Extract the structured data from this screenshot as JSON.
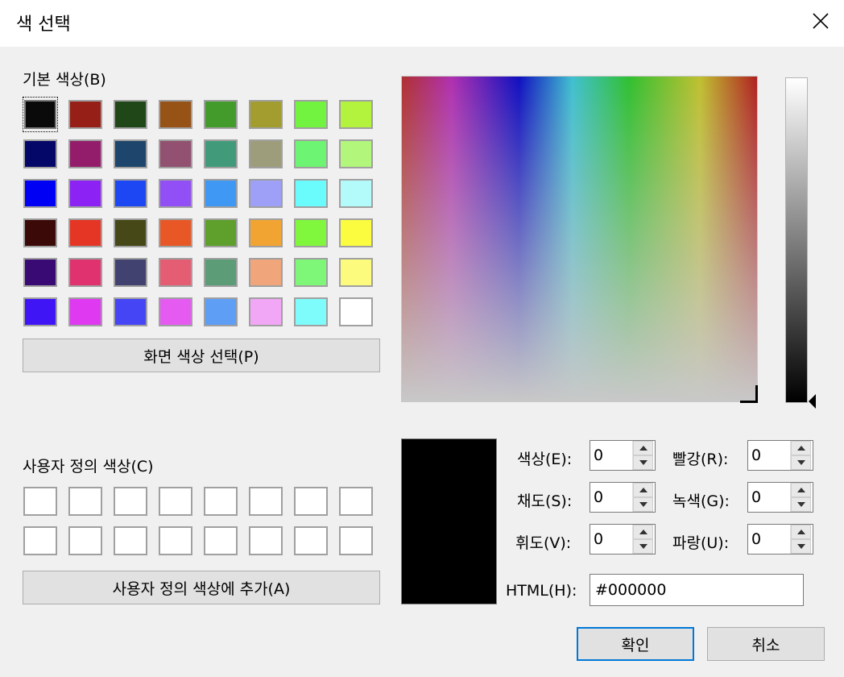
{
  "window": {
    "title": "색 선택"
  },
  "basic_colors": {
    "label": "기본 색상(B)",
    "swatches": [
      "#0a0a0a",
      "#961f18",
      "#1f4717",
      "#975216",
      "#429b2b",
      "#a29d2e",
      "#72f340",
      "#b3f33e",
      "#040668",
      "#931d6b",
      "#1e456c",
      "#925170",
      "#419b7a",
      "#9e9d7b",
      "#6df472",
      "#b2f67b",
      "#0000f5",
      "#8d22f4",
      "#1e47f4",
      "#914ff5",
      "#3f98f4",
      "#9e9ff6",
      "#6afbfc",
      "#b3fbfb",
      "#3b0a08",
      "#e53524",
      "#464817",
      "#e85826",
      "#5ea02b",
      "#f2a432",
      "#80f73d",
      "#fbfc40",
      "#3a0a74",
      "#e0326e",
      "#41426f",
      "#e45d72",
      "#5c9d77",
      "#f0a57b",
      "#7ef678",
      "#fcfb7d",
      "#3f15f6",
      "#df39f1",
      "#4645f6",
      "#e55bf2",
      "#5f9ef5",
      "#f1a6f6",
      "#7efbfb",
      "#ffffff"
    ]
  },
  "pick_screen_button": "화면 색상 선택(P)",
  "custom_colors": {
    "label": "사용자 정의 색상(C)",
    "swatches": [
      "#ffffff",
      "#ffffff",
      "#ffffff",
      "#ffffff",
      "#ffffff",
      "#ffffff",
      "#ffffff",
      "#ffffff",
      "#ffffff",
      "#ffffff",
      "#ffffff",
      "#ffffff",
      "#ffffff",
      "#ffffff",
      "#ffffff",
      "#ffffff"
    ]
  },
  "add_custom_button": "사용자 정의 색상에 추가(A)",
  "fields": {
    "hue": {
      "label": "색상(E):",
      "value": "0"
    },
    "sat": {
      "label": "채도(S):",
      "value": "0"
    },
    "lum": {
      "label": "휘도(V):",
      "value": "0"
    },
    "red": {
      "label": "빨강(R):",
      "value": "0"
    },
    "green": {
      "label": "녹색(G):",
      "value": "0"
    },
    "blue": {
      "label": "파랑(U):",
      "value": "0"
    },
    "html": {
      "label": "HTML(H):",
      "value": "#000000"
    }
  },
  "preview_color": "#000000",
  "buttons": {
    "ok": "확인",
    "cancel": "취소"
  }
}
